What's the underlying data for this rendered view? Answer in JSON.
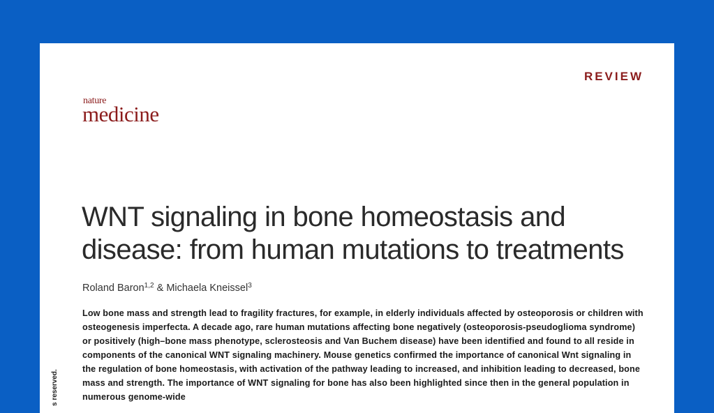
{
  "header": {
    "label": "REVIEW"
  },
  "logo": {
    "small": "nature",
    "big": "medicine"
  },
  "article": {
    "title": "WNT signaling in bone homeostasis and disease: from human mutations to treatments",
    "authors": [
      {
        "name": "Roland Baron",
        "sup": "1,2"
      },
      {
        "name": "Michaela Kneissel",
        "sup": "3"
      }
    ],
    "author_separator": " & ",
    "abstract": "Low bone mass and strength lead to fragility fractures, for example, in elderly individuals affected by osteoporosis or children with osteogenesis imperfecta. A decade ago, rare human mutations affecting bone negatively (osteoporosis-pseudoglioma syndrome) or positively (high–bone mass phenotype, sclerosteosis and Van Buchem disease) have been identified and found to all reside in components of the canonical WNT signaling machinery. Mouse genetics confirmed the importance of canonical Wnt signaling in the regulation of bone homeostasis, with activation of the pathway leading to increased, and inhibition leading to decreased, bone mass and strength. The importance of WNT signaling for bone has also been highlighted since then in the general population in numerous genome-wide"
  },
  "sidebar": {
    "text": "s reserved."
  }
}
